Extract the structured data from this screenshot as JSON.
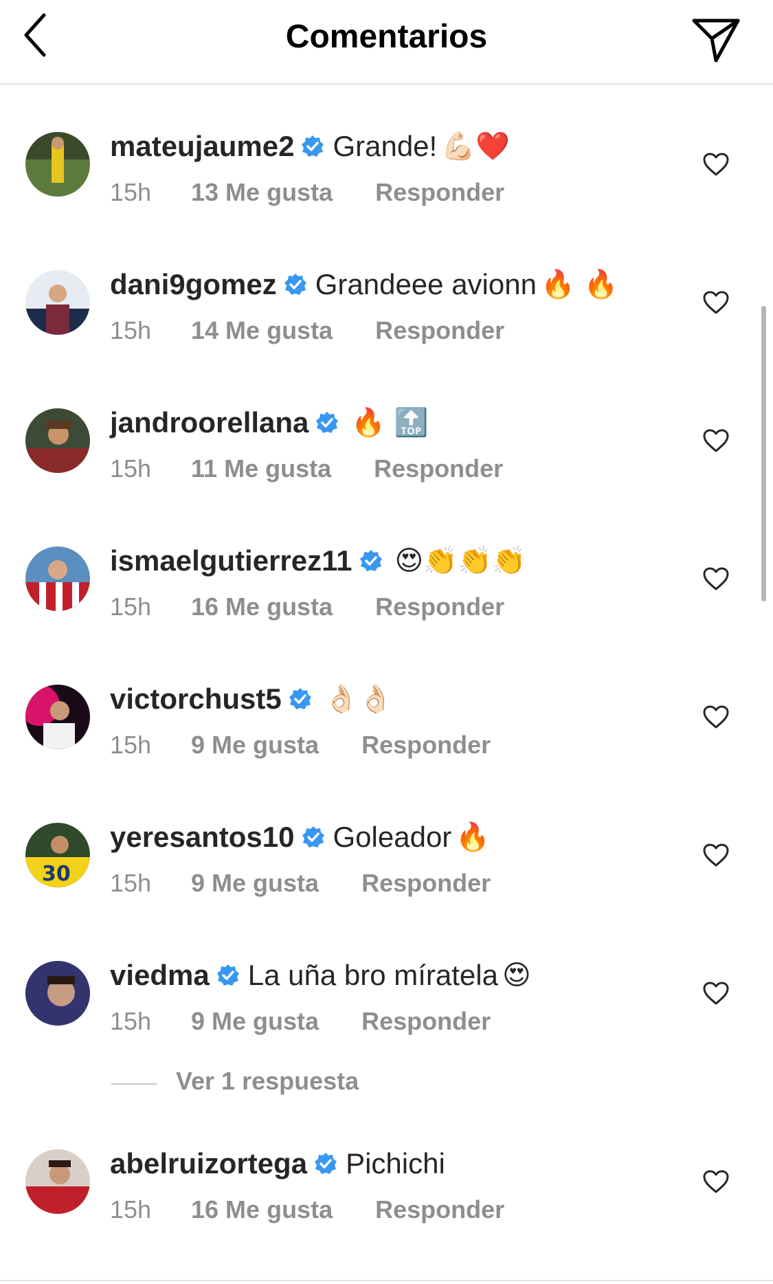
{
  "header": {
    "title": "Comentarios",
    "back_icon": "chevron-left-icon",
    "share_icon": "paper-plane-icon"
  },
  "colors": {
    "text": "#262626",
    "secondary": "#8e8e8e",
    "verified": "#3897f0",
    "divider": "#e2e2e2"
  },
  "comments": [
    {
      "username": "mateujaume2",
      "verified": true,
      "text": "Grande!",
      "emojis": "💪🏻❤️",
      "time": "15h",
      "likes": "13 Me gusta",
      "reply": "Responder"
    },
    {
      "username": "dani9gomez",
      "verified": true,
      "text": "Grandeee avionn",
      "emojis": "🔥 🔥",
      "time": "15h",
      "likes": "14 Me gusta",
      "reply": "Responder"
    },
    {
      "username": "jandroorellana",
      "verified": true,
      "text": "",
      "emojis": "🔥 🔝",
      "time": "15h",
      "likes": "11 Me gusta",
      "reply": "Responder"
    },
    {
      "username": "ismaelgutierrez11",
      "verified": true,
      "text": "",
      "emojis": "😍👏👏👏",
      "time": "15h",
      "likes": "16 Me gusta",
      "reply": "Responder"
    },
    {
      "username": "victorchust5",
      "verified": true,
      "text": "",
      "emojis": "👌🏻👌🏻",
      "time": "15h",
      "likes": "9 Me gusta",
      "reply": "Responder"
    },
    {
      "username": "yeresantos10",
      "verified": true,
      "text": "Goleador",
      "emojis": "🔥",
      "time": "15h",
      "likes": "9 Me gusta",
      "reply": "Responder"
    },
    {
      "username": "viedma",
      "verified": true,
      "text": "La uña bro míratela",
      "emojis": "😍",
      "time": "15h",
      "likes": "9 Me gusta",
      "reply": "Responder"
    },
    {
      "username": "abelruizortega",
      "verified": true,
      "text": "Pichichi",
      "emojis": "",
      "time": "15h",
      "likes": "16 Me gusta",
      "reply": "Responder"
    }
  ],
  "view_replies": {
    "label": "Ver 1 respuesta"
  }
}
